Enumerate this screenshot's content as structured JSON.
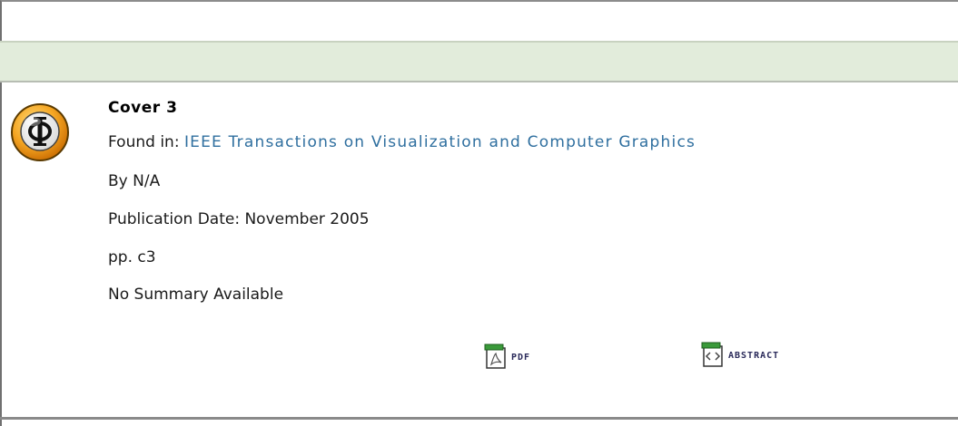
{
  "record": {
    "title": "Cover 3",
    "found_in_label": "Found in: ",
    "found_in_link": "IEEE Transactions on Visualization and Computer Graphics",
    "authors": "By N/A",
    "publication_date": "Publication Date: November 2005",
    "pages": "pp. c3",
    "summary": "No Summary Available"
  },
  "actions": {
    "pdf_label": "PDF",
    "abstract_label": "ABSTRACT"
  },
  "icons": {
    "logo": "ieee-phi-logo-icon",
    "pdf": "pdf-document-icon",
    "abstract": "abstract-document-icon"
  },
  "colors": {
    "band": "#e2ecdb",
    "link": "#2f6f9f",
    "logo_ring": "#f5a623"
  }
}
